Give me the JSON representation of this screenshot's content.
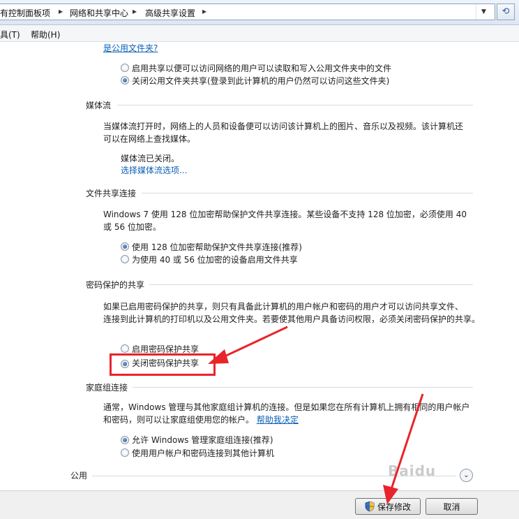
{
  "breadcrumbs": [
    "有控制面板项",
    "网络和共享中心",
    "高级共享设置"
  ],
  "icons": {
    "crumb_separator": "triangle-right-icon",
    "address_dropdown": "chevron-down-icon",
    "refresh": "refresh-icon",
    "shield": "uac-shield-icon",
    "scroll": "chevron-down-circle-icon"
  },
  "menu": [
    "具(T)",
    "帮助(H)"
  ],
  "public_folder": {
    "link_fragment": "是公用文件夹?",
    "options": [
      {
        "label": "启用共享以便可以访问网络的用户可以读取和写入公用文件夹中的文件",
        "selected": false
      },
      {
        "label": "关闭公用文件夹共享(登录到此计算机的用户仍然可以访问这些文件夹)",
        "selected": true
      }
    ]
  },
  "media": {
    "heading": "媒体流",
    "description_lines": [
      "当媒体流打开时，网络上的人员和设备便可以访问该计算机上的图片、音乐以及视频。该计算机还",
      "可以在网络上查找媒体。"
    ],
    "status": "媒体流已关闭。",
    "link": "选择媒体流选项..."
  },
  "file_sharing": {
    "heading": "文件共享连接",
    "description_lines": [
      "Windows 7 使用 128 位加密帮助保护文件共享连接。某些设备不支持 128 位加密，必须使用 40",
      "或 56 位加密。"
    ],
    "options": [
      {
        "label": "使用 128 位加密帮助保护文件共享连接(推荐)",
        "selected": true
      },
      {
        "label": "为使用 40 或 56 位加密的设备启用文件共享",
        "selected": false
      }
    ]
  },
  "password": {
    "heading": "密码保护的共享",
    "description_lines": [
      "如果已启用密码保护的共享，则只有具备此计算机的用户帐户和密码的用户才可以访问共享文件、",
      "连接到此计算机的打印机以及公用文件夹。若要使其他用户具备访问权限，必须关闭密码保护的共享。"
    ],
    "options": [
      {
        "label": "启用密码保护共享",
        "selected": false
      },
      {
        "label": "关闭密码保护共享",
        "selected": true
      }
    ]
  },
  "homegroup": {
    "heading": "家庭组连接",
    "description_line1": "通常，Windows 管理与其他家庭组计算机的连接。但是如果您在所有计算机上拥有相同的用户帐户",
    "description_line2": "和密码，则可以让家庭组使用您的帐户。",
    "help_link": "帮助我决定",
    "options": [
      {
        "label": "允许 Windows 管理家庭组连接(推荐)",
        "selected": true
      },
      {
        "label": "使用用户帐户和密码连接到其他计算机",
        "selected": false
      }
    ]
  },
  "public_section": {
    "heading": "公用"
  },
  "buttons": {
    "save": "保存修改",
    "cancel": "取消"
  },
  "watermark": "Baidu",
  "annotation_color": "#e8242a"
}
